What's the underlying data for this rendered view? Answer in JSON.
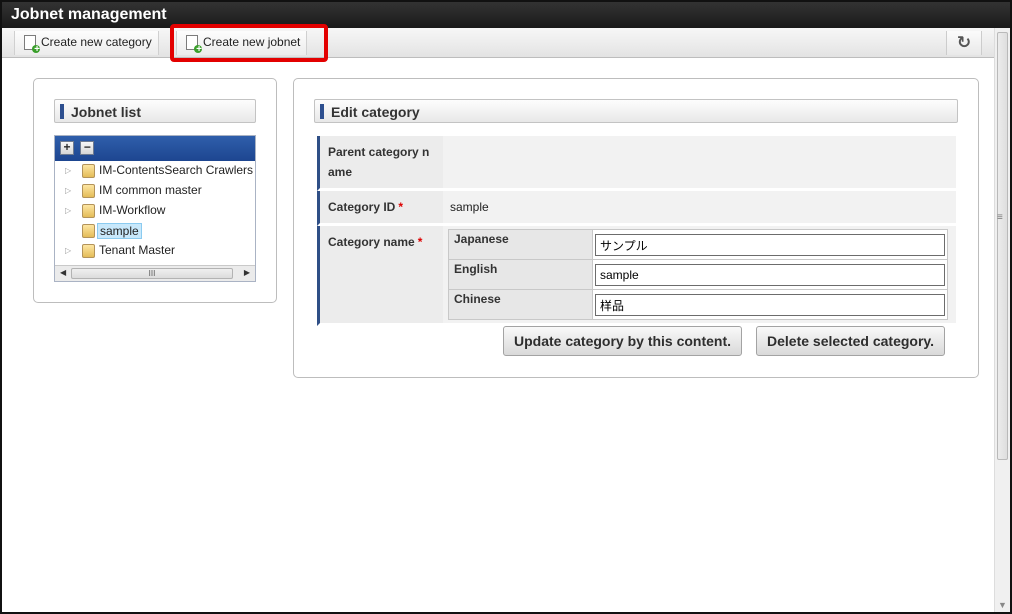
{
  "window": {
    "title": "Jobnet management"
  },
  "toolbar": {
    "create_category": "Create new category",
    "create_jobnet": "Create new jobnet",
    "refresh_icon": "refresh-icon"
  },
  "jobnet_list": {
    "title": "Jobnet list",
    "expand_all": "+",
    "collapse_all": "−",
    "items": [
      {
        "label": "IM-ContentsSearch Crawlers",
        "expandable": true
      },
      {
        "label": "IM common master",
        "expandable": true
      },
      {
        "label": "IM-Workflow",
        "expandable": true
      },
      {
        "label": "sample",
        "expandable": false,
        "selected": true
      },
      {
        "label": "Tenant Master",
        "expandable": true
      }
    ],
    "scroll_grip": "III"
  },
  "edit_category": {
    "title": "Edit category",
    "parent_label": "Parent category n ame",
    "parent_value": "",
    "id_label": "Category ID",
    "id_value": "sample",
    "name_label": "Category name",
    "required_mark": "*",
    "names": [
      {
        "language": "Japanese",
        "value": "サンプル"
      },
      {
        "language": "English",
        "value": "sample"
      },
      {
        "language": "Chinese",
        "value": "样品"
      }
    ],
    "update_button": "Update category by this content.",
    "delete_button": "Delete selected category."
  },
  "colors": {
    "highlight": "#e30000",
    "titlebar": "#222222",
    "tree_header": "#2f5fab",
    "accent": "#2f4f86"
  }
}
